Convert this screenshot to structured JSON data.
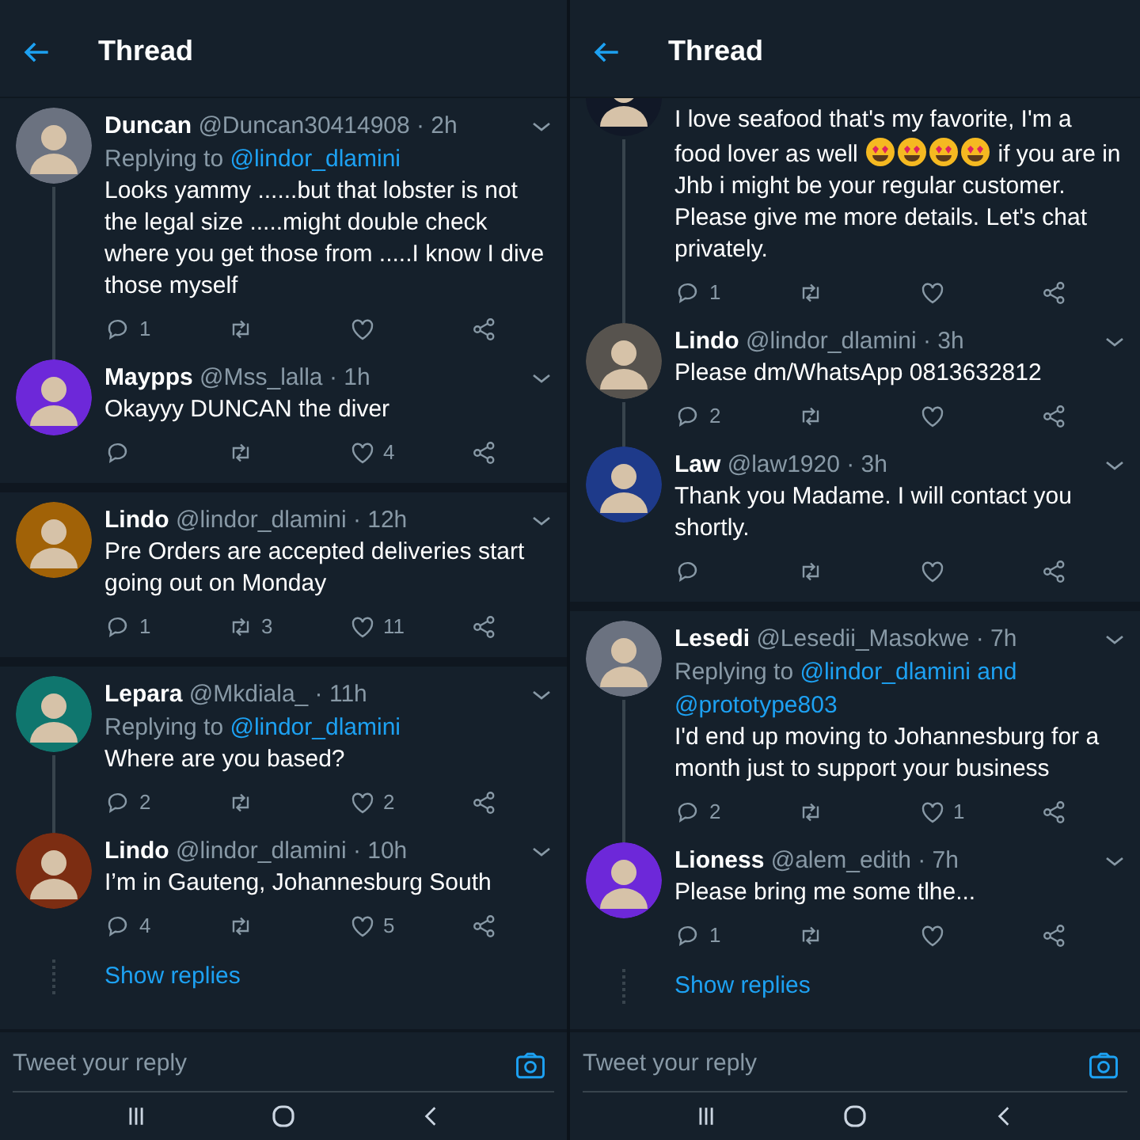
{
  "panels": [
    {
      "title": "Thread",
      "groups": [
        {
          "tweets": [
            {
              "name": "Duncan",
              "handle": "@Duncan30414908 · 2h",
              "replying_to": "Replying to",
              "reply_targets": "@lindor_dlamini",
              "text": [
                "Looks yammy ......but that lobster is not the legal size .....might double check where you get those from .....I know I dive those myself"
              ],
              "replies": "1",
              "thread_below": true
            },
            {
              "name": "Maypps",
              "handle": "@Mss_lalla · 1h",
              "text": [
                "Okayyy DUNCAN the diver"
              ],
              "likes": "4",
              "thread_below": false
            }
          ]
        },
        {
          "tweets": [
            {
              "name": "Lindo",
              "handle": "@lindor_dlamini · 12h",
              "text": [
                "Pre Orders are accepted deliveries start going out on Monday"
              ],
              "replies": "1",
              "retweets": "3",
              "likes": "11",
              "thread_below": false
            }
          ]
        },
        {
          "tweets": [
            {
              "name": "Lepara",
              "handle": "@Mkdiala_ · 11h",
              "replying_to": "Replying to",
              "reply_targets": "@lindor_dlamini",
              "text": [
                "Where are you based?"
              ],
              "replies": "2",
              "likes": "2",
              "thread_below": true
            },
            {
              "name": "Lindo",
              "handle": "@lindor_dlamini · 10h",
              "text": [
                "I’m in Gauteng, Johannesburg South"
              ],
              "replies": "4",
              "likes": "5",
              "thread_below": false
            }
          ],
          "show_replies": "Show replies"
        }
      ],
      "reply_placeholder": "Tweet your reply"
    },
    {
      "title": "Thread",
      "groups": [
        {
          "tweets": [
            {
              "clipped_top": true,
              "text": [
                {
                  "kind": "text",
                  "value": "I love seafood that's my favorite, I'm a food lover as well "
                },
                {
                  "kind": "emoji"
                },
                {
                  "kind": "emoji"
                },
                {
                  "kind": "emoji"
                },
                {
                  "kind": "emoji"
                },
                {
                  "kind": "text",
                  "value": " if you are in Jhb i might be your regular customer. Please give me more details. Let's chat privately."
                }
              ],
              "replies": "1",
              "thread_below": true
            },
            {
              "name": "Lindo",
              "handle": "@lindor_dlamini · 3h",
              "text": [
                "Please dm/WhatsApp 0813632812"
              ],
              "replies": "2",
              "thread_below": true
            },
            {
              "name": "Law",
              "handle": "@law1920 · 3h",
              "text": [
                "Thank you Madame. I will contact you shortly."
              ],
              "thread_below": false
            }
          ]
        },
        {
          "tweets": [
            {
              "name": "Lesedi",
              "handle": "@Lesedii_Masokwe · 7h",
              "replying_to": "Replying to",
              "reply_targets": [
                "@lindor_dlamini and",
                "@prototype803"
              ],
              "text": [
                "I'd end up moving to Johannesburg for a month just to support your business"
              ],
              "replies": "2",
              "likes": "1",
              "thread_below": true
            },
            {
              "name": "Lioness",
              "handle": "@alem_edith · 7h",
              "text": [
                "Please bring me some tlhe..."
              ],
              "replies": "1",
              "thread_below": false
            }
          ],
          "show_replies": "Show replies"
        }
      ],
      "reply_placeholder": "Tweet your reply"
    }
  ]
}
